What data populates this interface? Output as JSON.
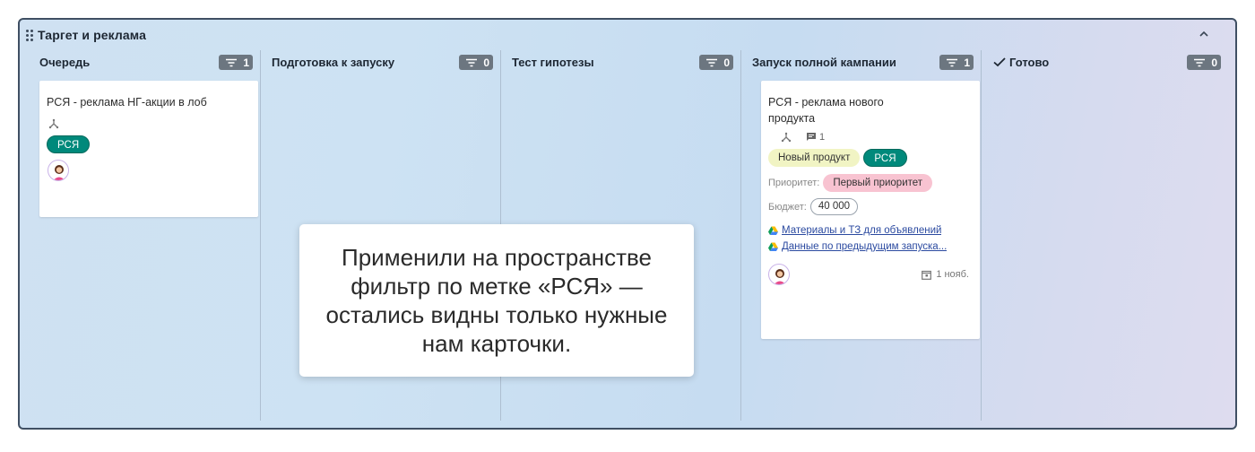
{
  "board": {
    "title": "Таргет и реклама"
  },
  "columns": [
    {
      "title": "Очередь",
      "count": "1"
    },
    {
      "title": "Подготовка к запуску",
      "count": "0"
    },
    {
      "title": "Тест гипотезы",
      "count": "0"
    },
    {
      "title": "Запуск полной кампании",
      "count": "1"
    },
    {
      "title": "Готово",
      "count": "0"
    }
  ],
  "cards": {
    "queue": {
      "title": "РСЯ - реклама НГ-акции в лоб",
      "tag": "РСЯ"
    },
    "launch": {
      "title": "РСЯ - реклама нового продукта",
      "comments": "1",
      "tags": [
        "Новый продукт",
        "РСЯ"
      ],
      "priority_label": "Приоритет:",
      "priority_value": "Первый приоритет",
      "budget_label": "Бюджет:",
      "budget_value": "40 000",
      "links": [
        "Материалы и ТЗ для объявлений",
        "Данные по предыдущим запуска..."
      ],
      "due": "1 нояб."
    }
  },
  "callout": {
    "text": "Применили на пространстве фильтр по метке «РСЯ» — остались видны только нужные нам карточки."
  },
  "colors": {
    "teal_tag": "#00897b",
    "yellow_tag": "#f1f4c4",
    "pink_tag": "#f8c3d1",
    "badge": "#6c7680",
    "frame_border": "#3f4f63"
  },
  "icons": {
    "drag": "drag-handle-icon",
    "collapse": "chevron-up-icon",
    "filter": "filter-lines-icon",
    "check": "checkmark-icon",
    "subtasks": "subtasks-icon",
    "comment": "comment-icon",
    "drive": "google-drive-icon",
    "calendar": "calendar-icon"
  }
}
